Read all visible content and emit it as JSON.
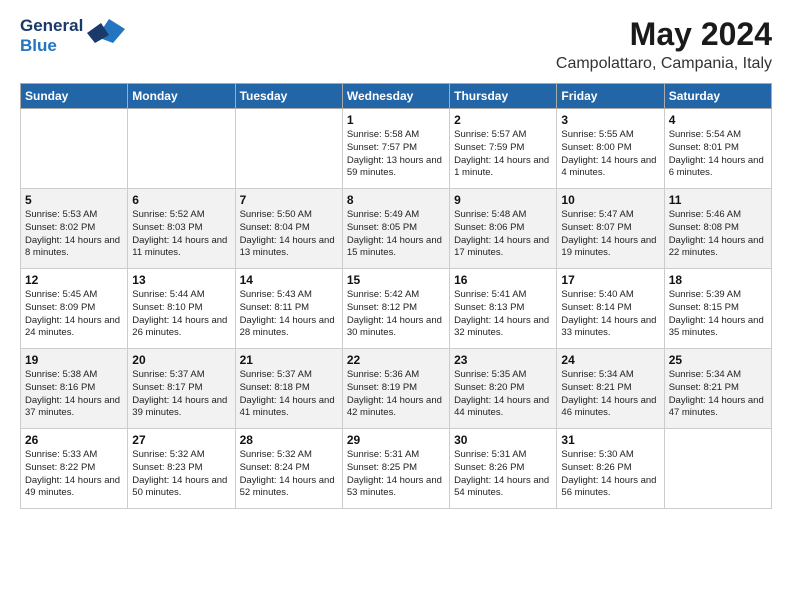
{
  "header": {
    "logo_line1": "General",
    "logo_line2": "Blue",
    "title": "May 2024",
    "subtitle": "Campolattaro, Campania, Italy"
  },
  "weekdays": [
    "Sunday",
    "Monday",
    "Tuesday",
    "Wednesday",
    "Thursday",
    "Friday",
    "Saturday"
  ],
  "weeks": [
    [
      {
        "day": "",
        "sunrise": "",
        "sunset": "",
        "daylight": ""
      },
      {
        "day": "",
        "sunrise": "",
        "sunset": "",
        "daylight": ""
      },
      {
        "day": "",
        "sunrise": "",
        "sunset": "",
        "daylight": ""
      },
      {
        "day": "1",
        "sunrise": "Sunrise: 5:58 AM",
        "sunset": "Sunset: 7:57 PM",
        "daylight": "Daylight: 13 hours and 59 minutes."
      },
      {
        "day": "2",
        "sunrise": "Sunrise: 5:57 AM",
        "sunset": "Sunset: 7:59 PM",
        "daylight": "Daylight: 14 hours and 1 minute."
      },
      {
        "day": "3",
        "sunrise": "Sunrise: 5:55 AM",
        "sunset": "Sunset: 8:00 PM",
        "daylight": "Daylight: 14 hours and 4 minutes."
      },
      {
        "day": "4",
        "sunrise": "Sunrise: 5:54 AM",
        "sunset": "Sunset: 8:01 PM",
        "daylight": "Daylight: 14 hours and 6 minutes."
      }
    ],
    [
      {
        "day": "5",
        "sunrise": "Sunrise: 5:53 AM",
        "sunset": "Sunset: 8:02 PM",
        "daylight": "Daylight: 14 hours and 8 minutes."
      },
      {
        "day": "6",
        "sunrise": "Sunrise: 5:52 AM",
        "sunset": "Sunset: 8:03 PM",
        "daylight": "Daylight: 14 hours and 11 minutes."
      },
      {
        "day": "7",
        "sunrise": "Sunrise: 5:50 AM",
        "sunset": "Sunset: 8:04 PM",
        "daylight": "Daylight: 14 hours and 13 minutes."
      },
      {
        "day": "8",
        "sunrise": "Sunrise: 5:49 AM",
        "sunset": "Sunset: 8:05 PM",
        "daylight": "Daylight: 14 hours and 15 minutes."
      },
      {
        "day": "9",
        "sunrise": "Sunrise: 5:48 AM",
        "sunset": "Sunset: 8:06 PM",
        "daylight": "Daylight: 14 hours and 17 minutes."
      },
      {
        "day": "10",
        "sunrise": "Sunrise: 5:47 AM",
        "sunset": "Sunset: 8:07 PM",
        "daylight": "Daylight: 14 hours and 19 minutes."
      },
      {
        "day": "11",
        "sunrise": "Sunrise: 5:46 AM",
        "sunset": "Sunset: 8:08 PM",
        "daylight": "Daylight: 14 hours and 22 minutes."
      }
    ],
    [
      {
        "day": "12",
        "sunrise": "Sunrise: 5:45 AM",
        "sunset": "Sunset: 8:09 PM",
        "daylight": "Daylight: 14 hours and 24 minutes."
      },
      {
        "day": "13",
        "sunrise": "Sunrise: 5:44 AM",
        "sunset": "Sunset: 8:10 PM",
        "daylight": "Daylight: 14 hours and 26 minutes."
      },
      {
        "day": "14",
        "sunrise": "Sunrise: 5:43 AM",
        "sunset": "Sunset: 8:11 PM",
        "daylight": "Daylight: 14 hours and 28 minutes."
      },
      {
        "day": "15",
        "sunrise": "Sunrise: 5:42 AM",
        "sunset": "Sunset: 8:12 PM",
        "daylight": "Daylight: 14 hours and 30 minutes."
      },
      {
        "day": "16",
        "sunrise": "Sunrise: 5:41 AM",
        "sunset": "Sunset: 8:13 PM",
        "daylight": "Daylight: 14 hours and 32 minutes."
      },
      {
        "day": "17",
        "sunrise": "Sunrise: 5:40 AM",
        "sunset": "Sunset: 8:14 PM",
        "daylight": "Daylight: 14 hours and 33 minutes."
      },
      {
        "day": "18",
        "sunrise": "Sunrise: 5:39 AM",
        "sunset": "Sunset: 8:15 PM",
        "daylight": "Daylight: 14 hours and 35 minutes."
      }
    ],
    [
      {
        "day": "19",
        "sunrise": "Sunrise: 5:38 AM",
        "sunset": "Sunset: 8:16 PM",
        "daylight": "Daylight: 14 hours and 37 minutes."
      },
      {
        "day": "20",
        "sunrise": "Sunrise: 5:37 AM",
        "sunset": "Sunset: 8:17 PM",
        "daylight": "Daylight: 14 hours and 39 minutes."
      },
      {
        "day": "21",
        "sunrise": "Sunrise: 5:37 AM",
        "sunset": "Sunset: 8:18 PM",
        "daylight": "Daylight: 14 hours and 41 minutes."
      },
      {
        "day": "22",
        "sunrise": "Sunrise: 5:36 AM",
        "sunset": "Sunset: 8:19 PM",
        "daylight": "Daylight: 14 hours and 42 minutes."
      },
      {
        "day": "23",
        "sunrise": "Sunrise: 5:35 AM",
        "sunset": "Sunset: 8:20 PM",
        "daylight": "Daylight: 14 hours and 44 minutes."
      },
      {
        "day": "24",
        "sunrise": "Sunrise: 5:34 AM",
        "sunset": "Sunset: 8:21 PM",
        "daylight": "Daylight: 14 hours and 46 minutes."
      },
      {
        "day": "25",
        "sunrise": "Sunrise: 5:34 AM",
        "sunset": "Sunset: 8:21 PM",
        "daylight": "Daylight: 14 hours and 47 minutes."
      }
    ],
    [
      {
        "day": "26",
        "sunrise": "Sunrise: 5:33 AM",
        "sunset": "Sunset: 8:22 PM",
        "daylight": "Daylight: 14 hours and 49 minutes."
      },
      {
        "day": "27",
        "sunrise": "Sunrise: 5:32 AM",
        "sunset": "Sunset: 8:23 PM",
        "daylight": "Daylight: 14 hours and 50 minutes."
      },
      {
        "day": "28",
        "sunrise": "Sunrise: 5:32 AM",
        "sunset": "Sunset: 8:24 PM",
        "daylight": "Daylight: 14 hours and 52 minutes."
      },
      {
        "day": "29",
        "sunrise": "Sunrise: 5:31 AM",
        "sunset": "Sunset: 8:25 PM",
        "daylight": "Daylight: 14 hours and 53 minutes."
      },
      {
        "day": "30",
        "sunrise": "Sunrise: 5:31 AM",
        "sunset": "Sunset: 8:26 PM",
        "daylight": "Daylight: 14 hours and 54 minutes."
      },
      {
        "day": "31",
        "sunrise": "Sunrise: 5:30 AM",
        "sunset": "Sunset: 8:26 PM",
        "daylight": "Daylight: 14 hours and 56 minutes."
      },
      {
        "day": "",
        "sunrise": "",
        "sunset": "",
        "daylight": ""
      }
    ]
  ]
}
